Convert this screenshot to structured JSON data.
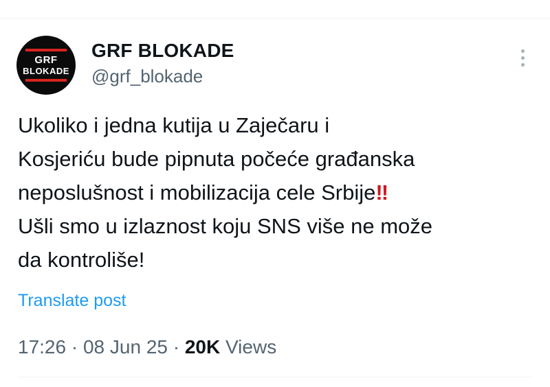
{
  "author": {
    "display_name": "GRF BLOKADE",
    "handle": "@grf_blokade",
    "avatar_text": [
      "GRF",
      "BLOKADE"
    ],
    "avatar_colors": {
      "background": "#0b0b0b",
      "bars": "#d9241e",
      "text": "#ffffff"
    }
  },
  "tweet": {
    "text": "Ukoliko i jedna kutija u Zaječaru i\nKosjeriću bude pipnuta počeće građanska\nneposlušnost i mobilizacija cele Srbije",
    "emoji": "‼",
    "text_after": "\nUšli smo u izlaznost koju SNS više ne može\nda kontroliše!",
    "translate_label": "Translate post"
  },
  "meta": {
    "time": "17:26",
    "separator": " · ",
    "date": "08 Jun 25",
    "views_count": "20K",
    "views_label": " Views"
  },
  "icons": {
    "more": "more-vertical-icon"
  },
  "colors": {
    "link": "#1d9bf0",
    "secondary_text": "#536471",
    "primary_text": "#0f1419"
  }
}
